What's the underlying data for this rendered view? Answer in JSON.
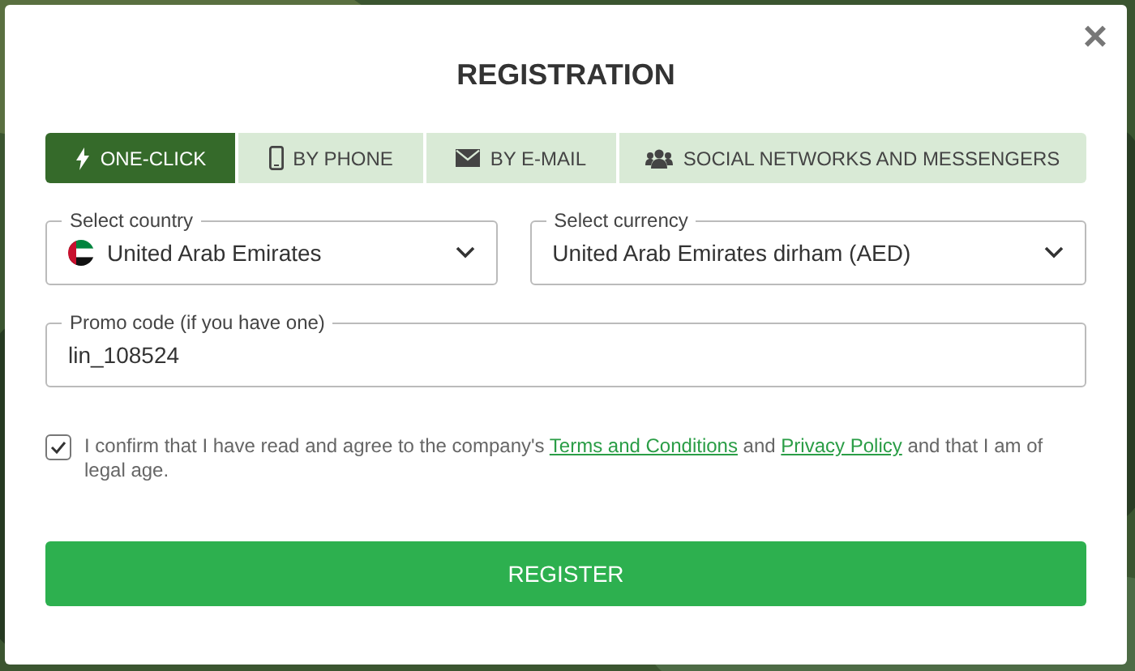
{
  "dialog": {
    "title": "REGISTRATION",
    "close": "×"
  },
  "tabs": [
    {
      "label": "ONE-CLICK",
      "kind": "bolt",
      "selected": true
    },
    {
      "label": "BY PHONE",
      "kind": "phone",
      "selected": false
    },
    {
      "label": "BY E-MAIL",
      "kind": "mail",
      "selected": false
    },
    {
      "label": "SOCIAL NETWORKS AND MESSENGERS",
      "kind": "people",
      "selected": false
    }
  ],
  "country": {
    "label": "Select country",
    "value": "United Arab Emirates"
  },
  "currency": {
    "label": "Select currency",
    "value": "United Arab Emirates dirham (AED)"
  },
  "promo": {
    "label": "Promo code (if you have one)",
    "value": "lin_108524"
  },
  "consent": {
    "checked": true,
    "parts": [
      {
        "kind": "text",
        "text": "I confirm that I have read and agree to the company's "
      },
      {
        "kind": "link",
        "text": "Terms and Conditions"
      },
      {
        "kind": "text",
        "text": " and "
      },
      {
        "kind": "link",
        "text": "Privacy Policy"
      },
      {
        "kind": "text",
        "text": " and that I am of legal age."
      }
    ]
  },
  "submit": "REGISTER"
}
